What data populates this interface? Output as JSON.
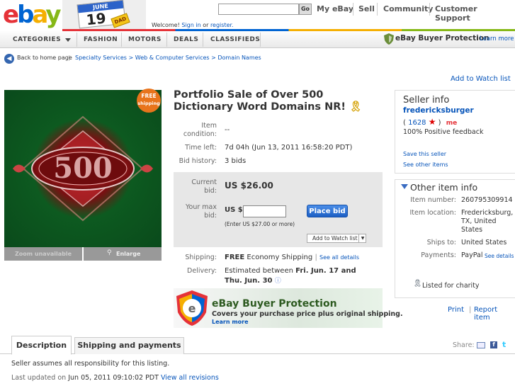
{
  "header": {
    "logo_letters": [
      "e",
      "b",
      "a",
      "y"
    ],
    "logo_colors": [
      "#e53238",
      "#0064d2",
      "#f5af02",
      "#86b817"
    ],
    "doodle_month": "JUNE",
    "doodle_day": "19",
    "doodle_badge": "DAD",
    "welcome_prefix": "Welcome!",
    "sign_in": "Sign in",
    "or": "or",
    "register": "register.",
    "search_button": "Go",
    "links": [
      "My eBay",
      "Sell",
      "Community",
      "Customer Support"
    ]
  },
  "nav": {
    "items": [
      "CATEGORIES",
      "FASHION",
      "MOTORS",
      "DEALS",
      "CLASSIFIEDS"
    ],
    "buyer_protection": "eBay Buyer Protection",
    "learn_more": "Learn more"
  },
  "breadcrumb": {
    "back": "Back to home page",
    "path": "Specialty Services > Web & Computer Services > Domain Names"
  },
  "add_watch_top": "Add to Watch list",
  "image": {
    "badge_line1": "FREE",
    "badge_line2": "shipping",
    "number": "500",
    "zoom": "Zoom unavailable",
    "enlarge": "Enlarge"
  },
  "listing": {
    "title": "Portfolio Sale of Over 500 Dictionary Word Domains NR!",
    "condition_label": "Item condition:",
    "condition_value": "--",
    "time_label": "Time left:",
    "time_value": "7d 04h (Jun 13, 2011 16:58:20 PDT)",
    "history_label": "Bid history:",
    "history_value": "3 bids",
    "current_label": "Current bid:",
    "current_value": "US $26.00",
    "max_label": "Your max bid:",
    "max_prefix": "US $",
    "max_hint": "(Enter US $27.00 or more)",
    "place_bid": "Place bid",
    "add_watch": "Add to Watch list",
    "shipping_label": "Shipping:",
    "shipping_free": "FREE",
    "shipping_method": "Economy Shipping",
    "shipping_details": "See all details",
    "delivery_label": "Delivery:",
    "delivery_prefix": "Estimated between",
    "delivery_dates": "Fri. Jun. 17 and Thu. Jun. 30"
  },
  "banner": {
    "title": "eBay Buyer Protection",
    "subtitle": "Covers your purchase price plus original shipping.",
    "learn_more": "Learn more"
  },
  "seller": {
    "heading": "Seller info",
    "name": "fredericksburger",
    "score": "1628",
    "me": "me",
    "feedback": "100% Positive feedback",
    "save": "Save this seller",
    "other": "See other items"
  },
  "other_info": {
    "heading": "Other item info",
    "rows": [
      {
        "label": "Item number:",
        "value": "260795309914"
      },
      {
        "label": "Item location:",
        "value": "Fredericksburg, TX, United States"
      },
      {
        "label": "Ships to:",
        "value": "United States"
      },
      {
        "label": "Payments:",
        "value": "PayPal"
      }
    ],
    "payments_details": "See details",
    "charity": "Listed for charity"
  },
  "actions": {
    "print": "Print",
    "report": "Report item"
  },
  "tabs": [
    "Description",
    "Shipping and payments"
  ],
  "share": "Share:",
  "description": {
    "line1": "Seller assumes all responsibility for this listing.",
    "updated_prefix": "Last updated on",
    "updated_date": "Jun 05, 2011 09:10:02 PDT",
    "view_revisions": "View all revisions"
  }
}
